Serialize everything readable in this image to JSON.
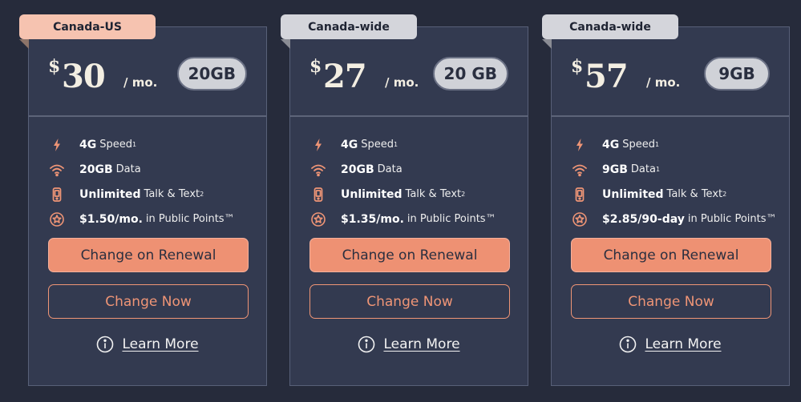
{
  "plans": [
    {
      "tab": "Canada-US",
      "currency": "$",
      "price": "30",
      "per": "/ mo.",
      "data_badge": "20GB",
      "features": {
        "speed": {
          "bold": "4G",
          "rest": "Speed",
          "sup": "1"
        },
        "data": {
          "bold": "20GB",
          "rest": "Data",
          "sup": ""
        },
        "talk": {
          "bold": "Unlimited",
          "rest": "Talk & Text",
          "sup": "2"
        },
        "points": {
          "bold": "$1.50/mo.",
          "rest": "in Public Points™"
        }
      },
      "renew_label": "Change on Renewal",
      "now_label": "Change Now",
      "learn_label": "Learn More"
    },
    {
      "tab": "Canada-wide",
      "currency": "$",
      "price": "27",
      "per": "/ mo.",
      "data_badge": "20 GB",
      "features": {
        "speed": {
          "bold": "4G",
          "rest": "Speed",
          "sup": "1"
        },
        "data": {
          "bold": "20GB",
          "rest": "Data",
          "sup": ""
        },
        "talk": {
          "bold": "Unlimited",
          "rest": "Talk & Text",
          "sup": "2"
        },
        "points": {
          "bold": "$1.35/mo.",
          "rest": "in Public Points™"
        }
      },
      "renew_label": "Change on Renewal",
      "now_label": "Change Now",
      "learn_label": "Learn More"
    },
    {
      "tab": "Canada-wide",
      "currency": "$",
      "price": "57",
      "per": "/ mo.",
      "data_badge": "9GB",
      "features": {
        "speed": {
          "bold": "4G",
          "rest": "Speed",
          "sup": "1"
        },
        "data": {
          "bold": "9GB",
          "rest": "Data",
          "sup": "1"
        },
        "talk": {
          "bold": "Unlimited",
          "rest": "Talk & Text",
          "sup": "2"
        },
        "points": {
          "bold": "$2.85/90-day",
          "rest": "in Public Points™"
        }
      },
      "renew_label": "Change on Renewal",
      "now_label": "Change Now",
      "learn_label": "Learn More"
    }
  ],
  "colors": {
    "background": "#262b3b",
    "card": "#333a50",
    "accent": "#ee9173",
    "tab_highlight": "#f6c3b0",
    "tab_default": "#d4d5db"
  },
  "icons": [
    "lightning-icon",
    "wifi-icon",
    "phone-icon",
    "star-points-icon",
    "info-icon"
  ]
}
